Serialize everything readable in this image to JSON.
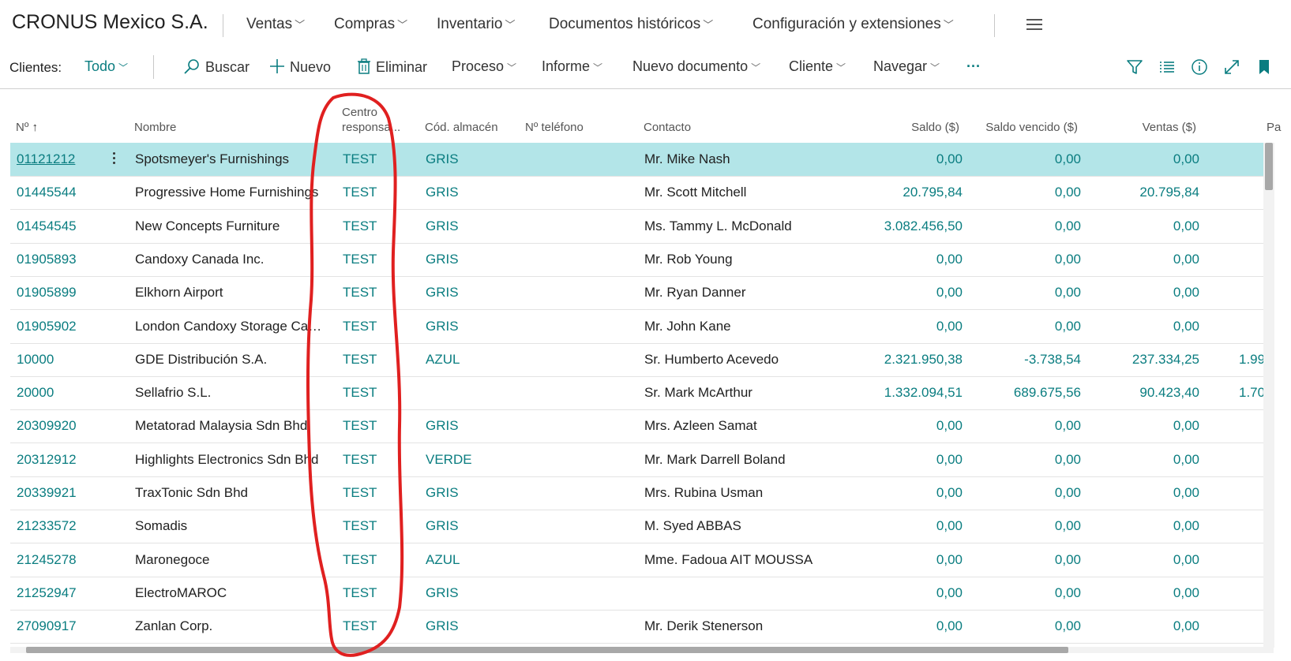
{
  "app": {
    "title": "CRONUS Mexico S.A."
  },
  "nav": {
    "items": [
      {
        "label": "Ventas"
      },
      {
        "label": "Compras"
      },
      {
        "label": "Inventario"
      },
      {
        "label": "Documentos históricos"
      },
      {
        "label": "Configuración y extensiones"
      }
    ]
  },
  "actions": {
    "clientes_label": "Clientes:",
    "view_filter": "Todo",
    "search": "Buscar",
    "new": "Nuevo",
    "delete": "Eliminar",
    "proceso": "Proceso",
    "informe": "Informe",
    "nuevo_documento": "Nuevo documento",
    "cliente": "Cliente",
    "navegar": "Navegar",
    "more": "···"
  },
  "columns": {
    "no": "Nº",
    "nombre": "Nombre",
    "centro_line1": "Centro",
    "centro_line2": "responsa...",
    "almacen": "Cód. almacén",
    "telefono": "Nº teléfono",
    "contacto": "Contacto",
    "saldo": "Saldo ($)",
    "saldo_vencido": "Saldo vencido ($)",
    "ventas": "Ventas ($)",
    "pa": "Pa"
  },
  "rows": [
    {
      "no": "01121212",
      "name": "Spotsmeyer's Furnishings",
      "centro": "TEST",
      "almacen": "GRIS",
      "contacto": "Mr. Mike Nash",
      "saldo": "0,00",
      "vencido": "0,00",
      "ventas": "0,00",
      "pa": ""
    },
    {
      "no": "01445544",
      "name": "Progressive Home Furnishings",
      "centro": "TEST",
      "almacen": "GRIS",
      "contacto": "Mr. Scott Mitchell",
      "saldo": "20.795,84",
      "vencido": "0,00",
      "ventas": "20.795,84",
      "pa": ""
    },
    {
      "no": "01454545",
      "name": "New Concepts Furniture",
      "centro": "TEST",
      "almacen": "GRIS",
      "contacto": "Ms. Tammy L. McDonald",
      "saldo": "3.082.456,50",
      "vencido": "0,00",
      "ventas": "0,00",
      "pa": ""
    },
    {
      "no": "01905893",
      "name": "Candoxy Canada Inc.",
      "centro": "TEST",
      "almacen": "GRIS",
      "contacto": "Mr. Rob Young",
      "saldo": "0,00",
      "vencido": "0,00",
      "ventas": "0,00",
      "pa": ""
    },
    {
      "no": "01905899",
      "name": "Elkhorn Airport",
      "centro": "TEST",
      "almacen": "GRIS",
      "contacto": "Mr. Ryan Danner",
      "saldo": "0,00",
      "vencido": "0,00",
      "ventas": "0,00",
      "pa": ""
    },
    {
      "no": "01905902",
      "name": "London Candoxy Storage Cam...",
      "centro": "TEST",
      "almacen": "GRIS",
      "contacto": "Mr. John Kane",
      "saldo": "0,00",
      "vencido": "0,00",
      "ventas": "0,00",
      "pa": ""
    },
    {
      "no": "10000",
      "name": "GDE Distribución S.A.",
      "centro": "TEST",
      "almacen": "AZUL",
      "contacto": "Sr. Humberto Acevedo",
      "saldo": "2.321.950,38",
      "vencido": "-3.738,54",
      "ventas": "237.334,25",
      "pa": "1.99"
    },
    {
      "no": "20000",
      "name": "Sellafrio S.L.",
      "centro": "TEST",
      "almacen": "",
      "contacto": "Sr. Mark McArthur",
      "saldo": "1.332.094,51",
      "vencido": "689.675,56",
      "ventas": "90.423,40",
      "pa": "1.70"
    },
    {
      "no": "20309920",
      "name": "Metatorad Malaysia Sdn Bhd",
      "centro": "TEST",
      "almacen": "GRIS",
      "contacto": "Mrs. Azleen Samat",
      "saldo": "0,00",
      "vencido": "0,00",
      "ventas": "0,00",
      "pa": ""
    },
    {
      "no": "20312912",
      "name": "Highlights Electronics Sdn Bhd",
      "centro": "TEST",
      "almacen": "VERDE",
      "contacto": "Mr. Mark Darrell Boland",
      "saldo": "0,00",
      "vencido": "0,00",
      "ventas": "0,00",
      "pa": ""
    },
    {
      "no": "20339921",
      "name": "TraxTonic Sdn Bhd",
      "centro": "TEST",
      "almacen": "GRIS",
      "contacto": "Mrs. Rubina Usman",
      "saldo": "0,00",
      "vencido": "0,00",
      "ventas": "0,00",
      "pa": ""
    },
    {
      "no": "21233572",
      "name": "Somadis",
      "centro": "TEST",
      "almacen": "GRIS",
      "contacto": "M. Syed ABBAS",
      "saldo": "0,00",
      "vencido": "0,00",
      "ventas": "0,00",
      "pa": ""
    },
    {
      "no": "21245278",
      "name": "Maronegoce",
      "centro": "TEST",
      "almacen": "AZUL",
      "contacto": "Mme. Fadoua AIT MOUSSA",
      "saldo": "0,00",
      "vencido": "0,00",
      "ventas": "0,00",
      "pa": ""
    },
    {
      "no": "21252947",
      "name": "ElectroMAROC",
      "centro": "TEST",
      "almacen": "GRIS",
      "contacto": "",
      "saldo": "0,00",
      "vencido": "0,00",
      "ventas": "0,00",
      "pa": ""
    },
    {
      "no": "27090917",
      "name": "Zanlan Corp.",
      "centro": "TEST",
      "almacen": "GRIS",
      "contacto": "Mr. Derik Stenerson",
      "saldo": "0,00",
      "vencido": "0,00",
      "ventas": "0,00",
      "pa": ""
    }
  ],
  "icons": {
    "filter": "filter-icon",
    "list": "list-view-icon",
    "info": "info-icon",
    "expand": "expand-icon",
    "bookmark": "bookmark-icon",
    "menu": "hamburger-menu-icon",
    "search": "search-icon",
    "new": "plus-icon",
    "delete": "trash-icon",
    "sort": "sort-ascending-icon"
  },
  "colors": {
    "accent": "#0a7d80",
    "selected_row": "#b3e5e8",
    "annotation": "#e02020"
  }
}
